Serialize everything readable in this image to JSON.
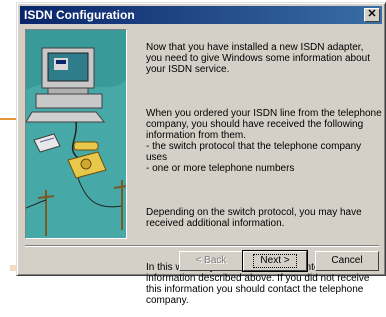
{
  "window": {
    "title": "ISDN Configuration",
    "close_glyph": "✕"
  },
  "description": {
    "p1": "Now that you have installed a new ISDN adapter, you need to give Windows some information about your ISDN service.",
    "p2": "When you ordered your ISDN line from the telephone company, you should have received the following information from them.\n- the switch protocol that the telephone company uses\n- one or more telephone numbers",
    "p3": "Depending on the switch protocol, you may have received additional information.",
    "p4": "In this wizard, you will be asked to enter the information described above.  If you did not receive this information you should contact the telephone company."
  },
  "buttons": {
    "back": "< Back",
    "next": "Next >",
    "cancel": "Cancel"
  },
  "icons": {
    "illustration": "computer-telephone-illustration"
  },
  "colors": {
    "title_start": "#0a246a",
    "title_end": "#3a6ea5",
    "face": "#d4d0c8",
    "art_bg": "#3a9a9a"
  }
}
